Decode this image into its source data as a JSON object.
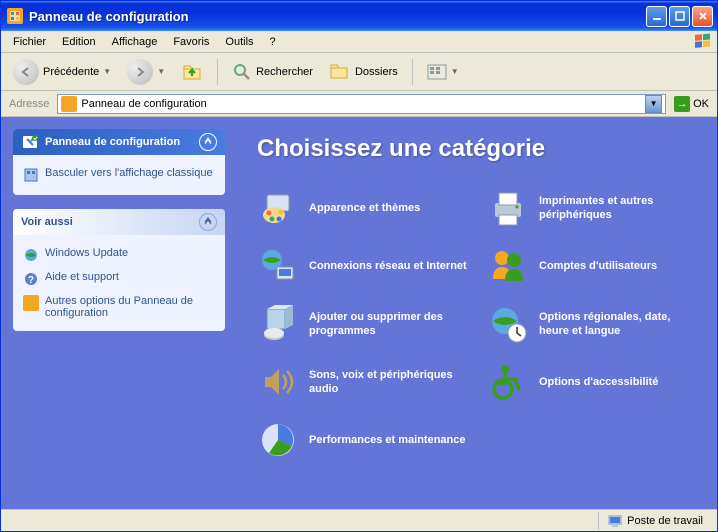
{
  "window": {
    "title": "Panneau de configuration"
  },
  "menu": {
    "file": "Fichier",
    "edit": "Edition",
    "view": "Affichage",
    "favorites": "Favoris",
    "tools": "Outils",
    "help": "?"
  },
  "toolbar": {
    "back": "Précédente",
    "search": "Rechercher",
    "folders": "Dossiers"
  },
  "address": {
    "label": "Adresse",
    "value": "Panneau de configuration",
    "ok": "OK"
  },
  "sidebar": {
    "panel1": {
      "title": "Panneau de configuration",
      "switch_view": "Basculer vers l'affichage classique"
    },
    "panel2": {
      "title": "Voir aussi",
      "links": [
        "Windows Update",
        "Aide et support",
        "Autres options du Panneau de configuration"
      ]
    }
  },
  "main": {
    "title": "Choisissez une catégorie",
    "categories": [
      "Apparence et thèmes",
      "Imprimantes et autres périphériques",
      "Connexions réseau et Internet",
      "Comptes d'utilisateurs",
      "Ajouter ou supprimer des programmes",
      "Options régionales, date, heure et langue",
      "Sons, voix et périphériques audio",
      "Options d'accessibilité",
      "Performances et maintenance"
    ]
  },
  "status": {
    "location": "Poste de travail"
  }
}
